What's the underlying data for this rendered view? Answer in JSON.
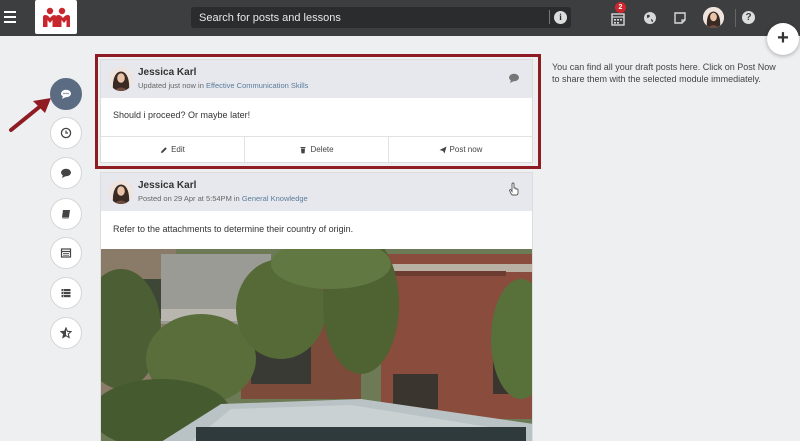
{
  "topbar": {
    "search_placeholder": "Search for posts and lessons",
    "calendar_badge": "2"
  },
  "side_note": "You can find all your draft posts here. Click on Post Now to share them with the selected module immediately.",
  "draft_post": {
    "author": "Jessica Karl",
    "meta_prefix": "Updated just now in ",
    "module": "Effective Communication Skills",
    "body": "Should i proceed? Or maybe later!",
    "actions": {
      "edit": "Edit",
      "delete": "Delete",
      "post_now": "Post now"
    }
  },
  "feed_post": {
    "author": "Jessica Karl",
    "meta_prefix": "Posted on 29 Apr at 5:54PM in ",
    "module": "General Knowledge",
    "body": "Refer to the attachments to determine their country of origin."
  },
  "colors": {
    "topbar": "#3d3e40",
    "brand_red": "#c8262d",
    "highlight": "#8e1c22",
    "rail_active": "#5b6b82"
  }
}
